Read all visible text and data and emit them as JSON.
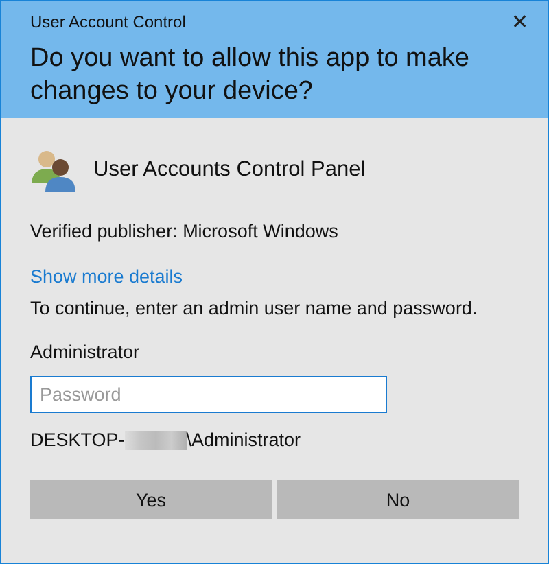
{
  "window": {
    "title": "User Account Control",
    "close": "✕"
  },
  "question": "Do you want to allow this app to make changes to your device?",
  "program": {
    "name": "User Accounts Control Panel"
  },
  "publisher": "Verified publisher: Microsoft Windows",
  "details_link": "Show more details",
  "instruction": "To continue, enter an admin user name and password.",
  "username": "Administrator",
  "password": {
    "placeholder": "Password"
  },
  "account": {
    "prefix": "DESKTOP-",
    "suffix": "\\Administrator"
  },
  "buttons": [
    "Yes",
    "No"
  ]
}
